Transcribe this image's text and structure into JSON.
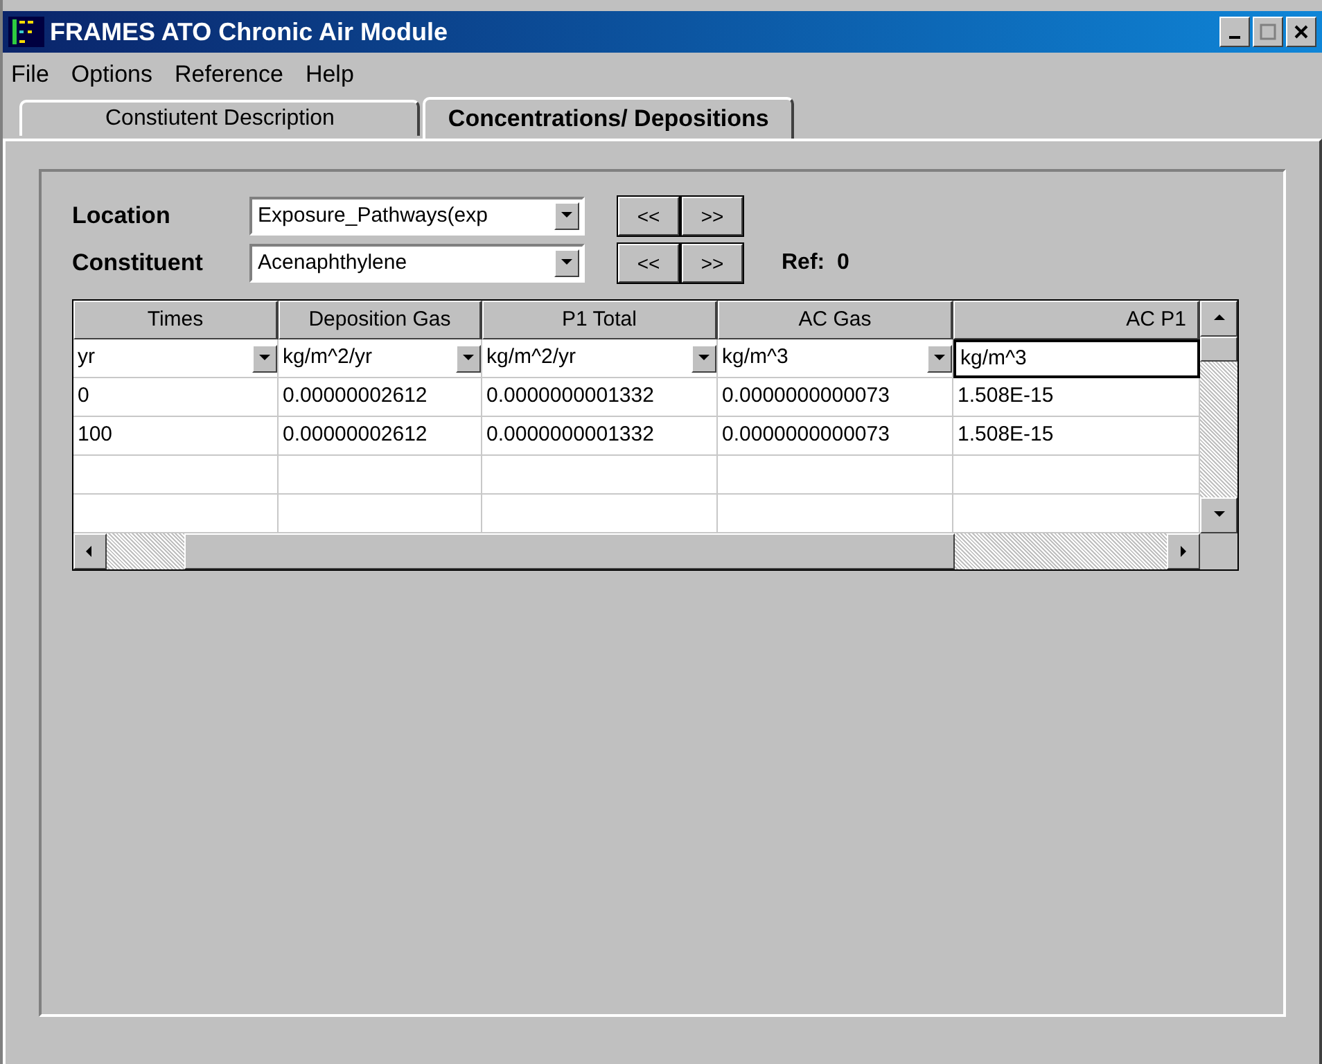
{
  "window": {
    "title": "FRAMES ATO Chronic Air Module"
  },
  "menu": [
    "File",
    "Options",
    "Reference",
    "Help"
  ],
  "tabs": [
    {
      "label": "Constiutent Description",
      "selected": false
    },
    {
      "label": "Concentrations/ Depositions",
      "selected": true
    }
  ],
  "location": {
    "label": "Location",
    "value": "Exposure_Pathways(exp",
    "prev": "<<",
    "next": ">>"
  },
  "constituent": {
    "label": "Constituent",
    "value": "Acenaphthylene",
    "prev": "<<",
    "next": ">>",
    "ref": "Ref:  0"
  },
  "table": {
    "columns": [
      "Times",
      "Deposition Gas",
      "P1 Total",
      "AC Gas",
      "AC P1"
    ],
    "units": [
      {
        "value": "yr",
        "dropdown": true,
        "selected": false
      },
      {
        "value": "kg/m^2/yr",
        "dropdown": true,
        "selected": false
      },
      {
        "value": "kg/m^2/yr",
        "dropdown": true,
        "selected": false
      },
      {
        "value": "kg/m^3",
        "dropdown": true,
        "selected": false
      },
      {
        "value": "kg/m^3",
        "dropdown": false,
        "selected": true
      }
    ],
    "rows": [
      [
        "0",
        "0.00000002612",
        "0.0000000001332",
        "0.0000000000073",
        "1.508E-15"
      ],
      [
        "100",
        "0.00000002612",
        "0.0000000001332",
        "0.0000000000073",
        "1.508E-15"
      ],
      [
        "",
        "",
        "",
        "",
        ""
      ],
      [
        "",
        "",
        "",
        "",
        ""
      ]
    ]
  }
}
